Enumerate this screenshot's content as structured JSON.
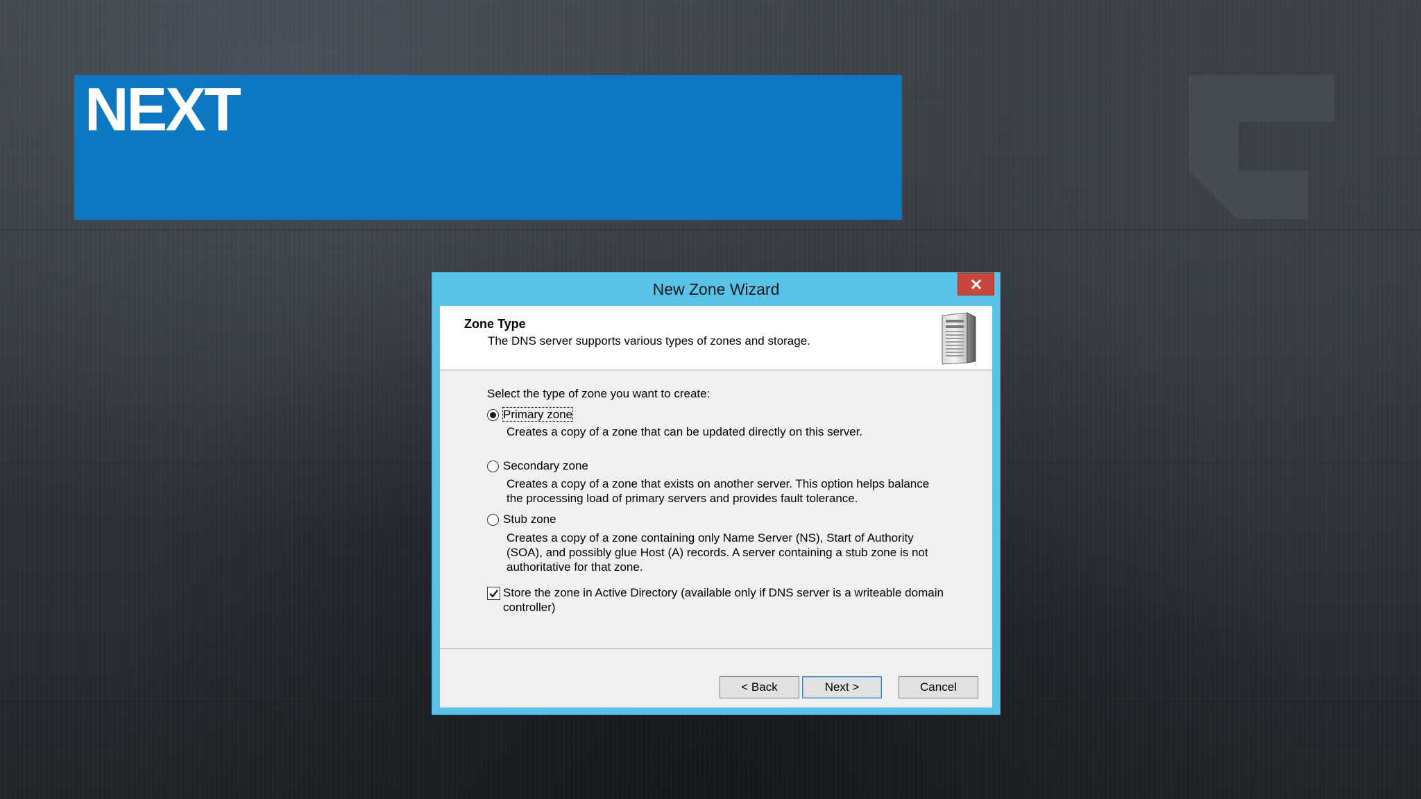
{
  "slide": {
    "title": "NEXT"
  },
  "colors": {
    "banner": "#0d78c2",
    "dialog_frame": "#5bc2e7",
    "close_button": "#c7463d"
  },
  "dialog": {
    "title": "New Zone Wizard",
    "close_label": "×",
    "header": {
      "title": "Zone Type",
      "description": "The DNS server supports various types of zones and storage.",
      "icon": "server-icon"
    },
    "prompt": "Select the type of zone you want to create:",
    "options": [
      {
        "label": "Primary zone",
        "selected": true,
        "description_lines": [
          "Creates a copy of a zone that can be updated directly on this server."
        ]
      },
      {
        "label": "Secondary zone",
        "selected": false,
        "description_lines": [
          "Creates a copy of a zone that exists on another server. This option helps balance",
          "the processing load of primary servers and provides fault tolerance."
        ]
      },
      {
        "label": "Stub zone",
        "selected": false,
        "description_lines": [
          "Creates a copy of a zone containing only Name Server (NS), Start of Authority",
          "(SOA), and possibly glue Host (A) records. A server containing a stub zone is not",
          "authoritative for that zone."
        ]
      }
    ],
    "store_in_ad": {
      "checked": true,
      "label_lines": [
        "Store the zone in Active Directory (available only if DNS server is a writeable domain",
        "controller)"
      ]
    },
    "buttons": {
      "back": "< Back",
      "next": "Next >",
      "cancel": "Cancel"
    }
  }
}
